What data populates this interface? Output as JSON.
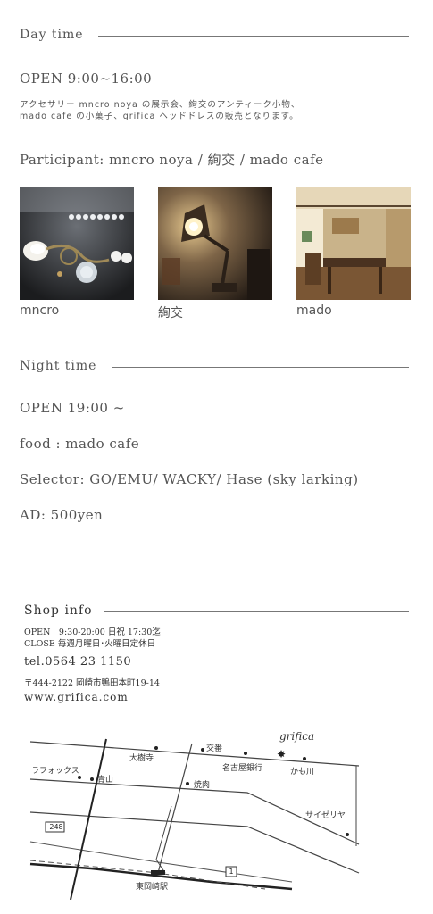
{
  "day": {
    "title": "Day time",
    "open": "OPEN 9:00~16:00",
    "desc_line1": "アクセサリー mncro noya の展示会、絢交のアンティーク小物、",
    "desc_line2": "mado cafe の小菓子、grifica ヘッドドレスの販売となります。",
    "participant": "Participant: mncro noya / 絢交 / mado cafe",
    "photos": [
      {
        "caption": "mncro"
      },
      {
        "caption": "絢交"
      },
      {
        "caption": "mado"
      }
    ]
  },
  "night": {
    "title": "Night time",
    "open": "OPEN 19:00 ~",
    "food": "food : mado cafe",
    "selector": "Selector: GO/EMU/ WACKY/ Hase (sky larking)",
    "ad": "AD: 500yen"
  },
  "shop": {
    "title": "Shop info",
    "open": "OPEN　9:30-20:00 日祝 17:30迄",
    "close": "CLOSE  毎週月曜日･火曜日定休日",
    "tel": "tel.0564 23 1150",
    "address": "〒444-2122 岡崎市鴨田本町19-14",
    "url": "www.grifica.com"
  },
  "map": {
    "labels": {
      "grifica": "grifica",
      "koban": "交番",
      "daijuji": "大樹寺",
      "nagoya_bank": "名古屋銀行",
      "kamokawa": "かも川",
      "laforkusu": "ラフォックス",
      "aoyama": "青山",
      "yakiniku": "焼肉",
      "saizeriya": "サイゼリヤ",
      "route248": "248",
      "route1": "1",
      "station": "東岡崎駅"
    }
  },
  "colors": {
    "text": "#555555",
    "rule": "#777777",
    "map_line": "#333333"
  }
}
